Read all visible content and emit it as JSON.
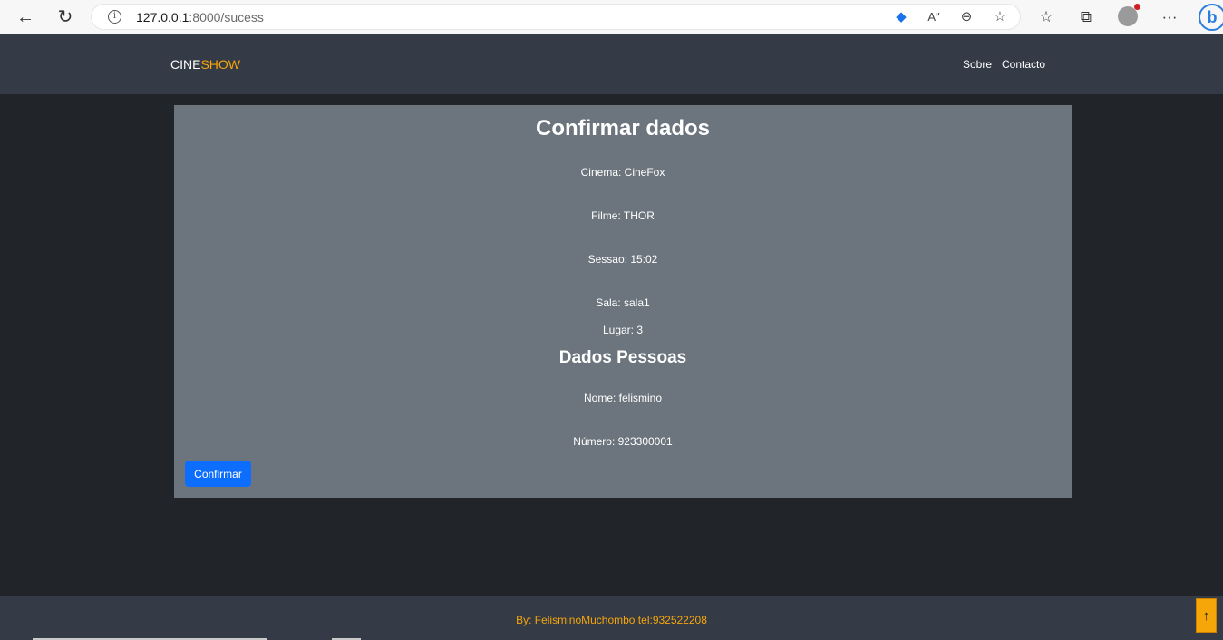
{
  "browser": {
    "url_host": "127.0.0.1",
    "url_rest": ":8000/sucess",
    "icons": [
      "back-icon",
      "refresh-icon",
      "info-icon",
      "tag-icon",
      "read-aloud-icon",
      "zoom-out-icon",
      "add-favorite-icon",
      "favorites-icon",
      "collections-icon",
      "profile-icon",
      "more-icon",
      "bing-icon"
    ],
    "glyphs": {
      "back": "←",
      "refresh": "↻",
      "info": "i",
      "tag": "◆",
      "read_aloud": "A″",
      "zoom_out": "⊖",
      "add_favorite": "☆",
      "favorites": "☆",
      "collections": "⧉",
      "more": "···",
      "bing": "b"
    }
  },
  "header": {
    "brand_a": "CINE",
    "brand_b": "SHOW",
    "nav": [
      "Sobre",
      "Contacto"
    ]
  },
  "main": {
    "title": "Confirmar dados",
    "details": [
      "Cinema: CineFox",
      "Filme: THOR",
      "Sessao: 15:02",
      "Sala: sala1",
      "Lugar: 3"
    ],
    "subtitle": "Dados Pessoas",
    "personal": [
      "Nome: felismino",
      "Número: 923300001"
    ],
    "confirm_label": "Confirmar"
  },
  "footer": {
    "credit": "By: FelisminoMuchombo tel:932522208",
    "to_top": "↑"
  },
  "colors": {
    "accent": "#f6a609",
    "primary": "#0d6efd",
    "card": "#6c757d",
    "header": "#343a46",
    "page": "#212529"
  }
}
